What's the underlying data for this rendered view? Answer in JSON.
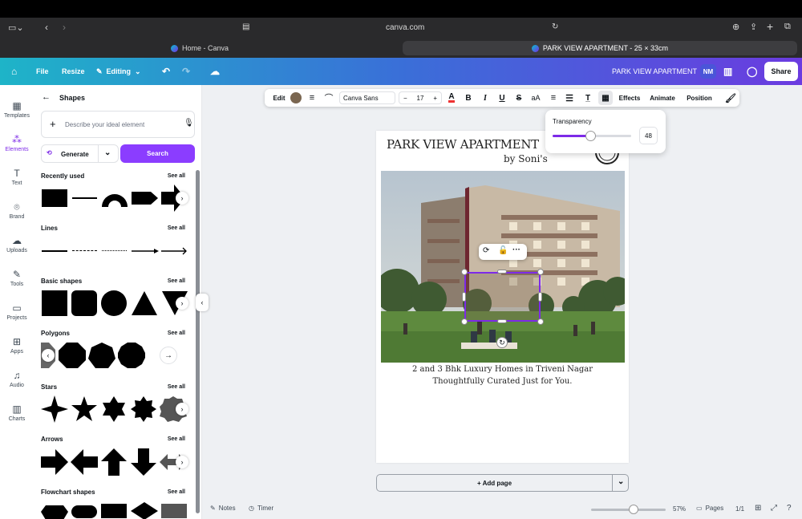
{
  "browser": {
    "url": "canva.com",
    "tabs": [
      {
        "title": "Home - Canva"
      },
      {
        "title": "PARK VIEW APARTMENT - 25 × 33cm"
      }
    ]
  },
  "header": {
    "file": "File",
    "resize": "Resize",
    "editing": "Editing",
    "doc_title": "PARK VIEW APARTMENT",
    "avatar": "NM",
    "share": "Share"
  },
  "rail": [
    {
      "label": "Templates",
      "icon": "templates-icon"
    },
    {
      "label": "Elements",
      "icon": "elements-icon"
    },
    {
      "label": "Text",
      "icon": "text-icon"
    },
    {
      "label": "Brand",
      "icon": "brand-icon"
    },
    {
      "label": "Uploads",
      "icon": "uploads-icon"
    },
    {
      "label": "Tools",
      "icon": "tools-icon"
    },
    {
      "label": "Projects",
      "icon": "projects-icon"
    },
    {
      "label": "Apps",
      "icon": "apps-icon"
    },
    {
      "label": "Audio",
      "icon": "audio-icon"
    },
    {
      "label": "Charts",
      "icon": "charts-icon"
    }
  ],
  "panel": {
    "title": "Shapes",
    "search_placeholder": "Describe your ideal element",
    "generate": "Generate",
    "search": "Search",
    "see_all": "See all",
    "sections": {
      "recent": "Recently used",
      "lines": "Lines",
      "basic": "Basic shapes",
      "polygons": "Polygons",
      "stars": "Stars",
      "arrows": "Arrows",
      "flowchart": "Flowchart shapes"
    }
  },
  "toolbar": {
    "edit": "Edit",
    "fill_color": "#7a6650",
    "font": "Canva Sans",
    "minus": "−",
    "font_size": "17",
    "plus": "+",
    "bold": "B",
    "italic": "I",
    "underline": "U",
    "strike": "S",
    "case": "aA",
    "effects": "Effects",
    "animate": "Animate",
    "position": "Position"
  },
  "transparency": {
    "label": "Transparency",
    "value": "48",
    "level": 0.48
  },
  "design": {
    "title": "PARK VIEW APARTMENT",
    "byline": "by Soni's",
    "line1": "2 and 3 Bhk Luxury Homes in Triveni Nagar",
    "line2": "Thoughtfully Curated Just for You."
  },
  "add_page": "+ Add page",
  "bottom": {
    "notes": "Notes",
    "timer": "Timer",
    "zoom": "57%",
    "zoom_level": 0.57,
    "pages": "Pages",
    "page_count": "1/1"
  },
  "colors": {
    "accent": "#7d2ae8",
    "search_btn": "#8b3dff"
  }
}
